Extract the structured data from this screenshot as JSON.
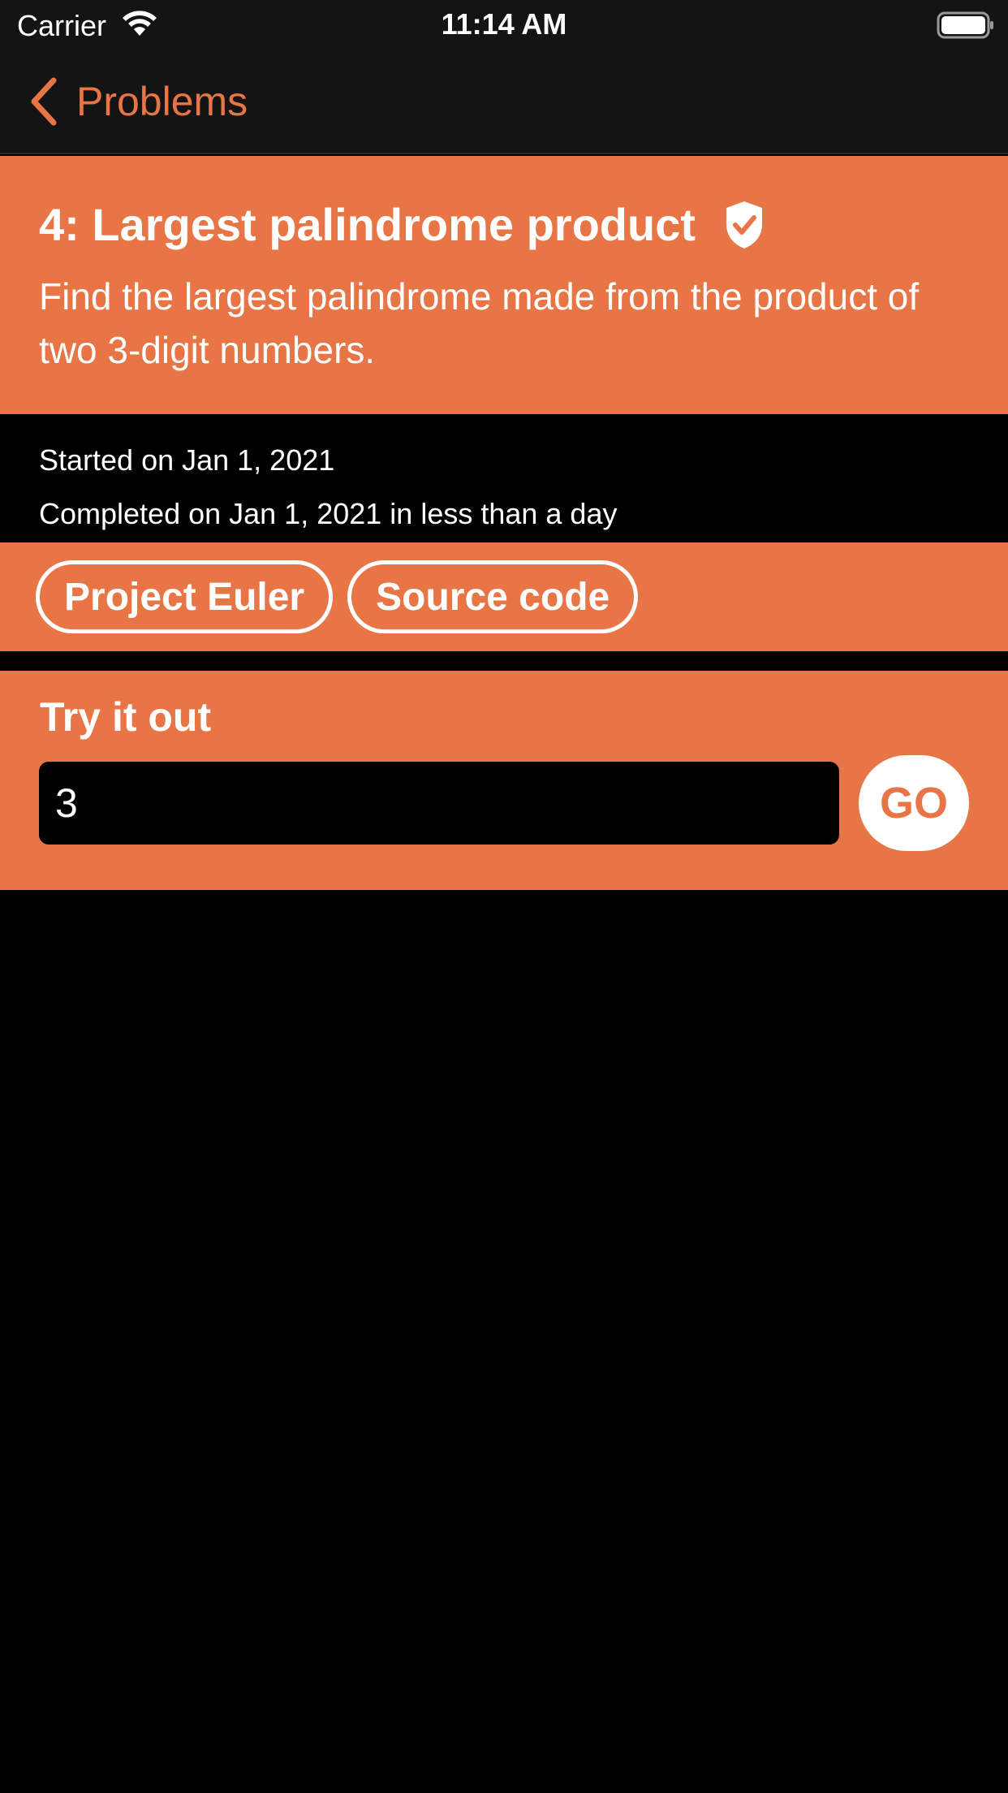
{
  "status_bar": {
    "carrier": "Carrier",
    "time": "11:14 AM",
    "icons": [
      "wifi-icon",
      "battery-icon"
    ]
  },
  "nav": {
    "back_label": "Problems",
    "back_icon": "chevron-left-icon"
  },
  "problem": {
    "title": "4: Largest palindrome product",
    "status_icon": "shield-check-icon",
    "description": "Find the largest palindrome made from the product of two 3-digit numbers."
  },
  "meta": {
    "started": "Started on Jan 1, 2021",
    "completed": "Completed on Jan 1, 2021 in less than a day"
  },
  "links": [
    {
      "label": "Project Euler"
    },
    {
      "label": "Source code"
    }
  ],
  "try_it": {
    "title": "Try it out",
    "input_value": "3",
    "go_label": "GO"
  },
  "colors": {
    "accent": "#e87545",
    "background": "#000000",
    "bar_background": "#141414",
    "text": "#ffffff"
  }
}
